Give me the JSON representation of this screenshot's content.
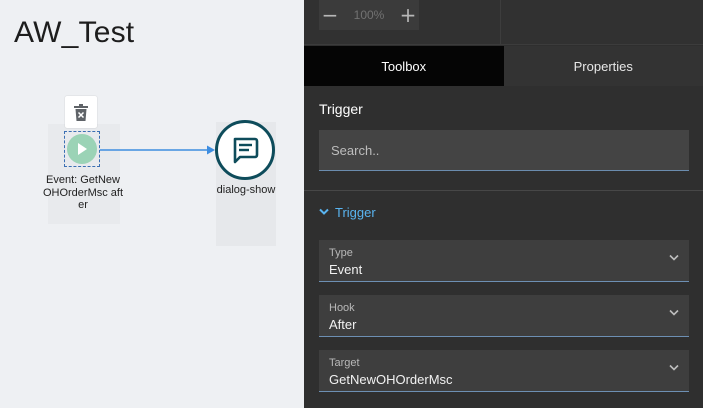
{
  "canvas": {
    "title": "AW_Test",
    "start_node": {
      "label": "Event: GetNewOHOrderMsc after"
    },
    "dialog_node": {
      "label": "dialog-show"
    }
  },
  "zoom": {
    "minus": "−",
    "value": "100%",
    "plus": "+"
  },
  "tabs": [
    {
      "label": "Toolbox"
    },
    {
      "label": "Properties"
    }
  ],
  "panel": {
    "section_title": "Trigger",
    "search_placeholder": "Search..",
    "accordion_label": "Trigger",
    "fields": [
      {
        "label": "Type",
        "value": "Event"
      },
      {
        "label": "Hook",
        "value": "After"
      },
      {
        "label": "Target",
        "value": "GetNewOHOrderMsc"
      }
    ]
  },
  "colors": {
    "accent": "#59b4f0",
    "dialog_ring": "#0e4c5b",
    "start_fill": "#9bd3b6",
    "connector": "#3d8de0"
  }
}
